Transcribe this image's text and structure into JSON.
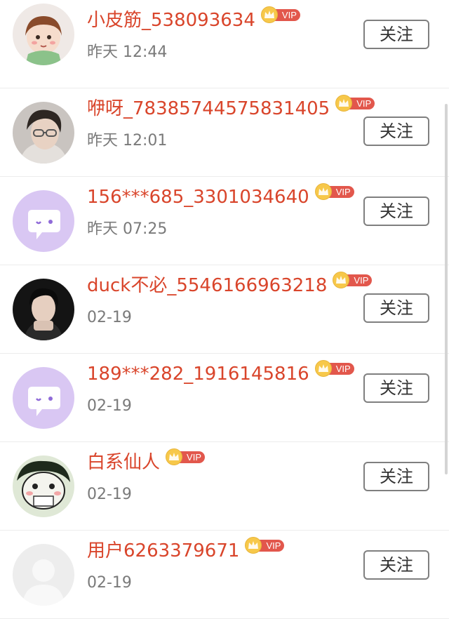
{
  "follow_label": "关注",
  "vip_label": "VIP",
  "users": [
    {
      "name": "小皮筋_538093634",
      "time": "昨天 12:44",
      "avatar": "cartoon-girl-avatar"
    },
    {
      "name": "咿呀_78385744575831405",
      "time": "昨天 12:01",
      "avatar": "man-with-glasses-avatar"
    },
    {
      "name": "156***685_3301034640",
      "time": "昨天 07:25",
      "avatar": "default-chat-bubble-avatar"
    },
    {
      "name": "duck不必_5546166963218",
      "time": "02-19",
      "avatar": "man-portrait-avatar"
    },
    {
      "name": "189***282_1916145816",
      "time": "02-19",
      "avatar": "default-chat-bubble-avatar"
    },
    {
      "name": "白系仙人",
      "time": "02-19",
      "avatar": "frog-meme-avatar"
    },
    {
      "name": "用户6263379671",
      "time": "02-19",
      "avatar": "default-grey-avatar"
    }
  ],
  "colors": {
    "name": "#d9452b",
    "vip_tag": "#e2574c",
    "crown": "#f7c84a",
    "bubble_bg": "#d9c7f3"
  }
}
